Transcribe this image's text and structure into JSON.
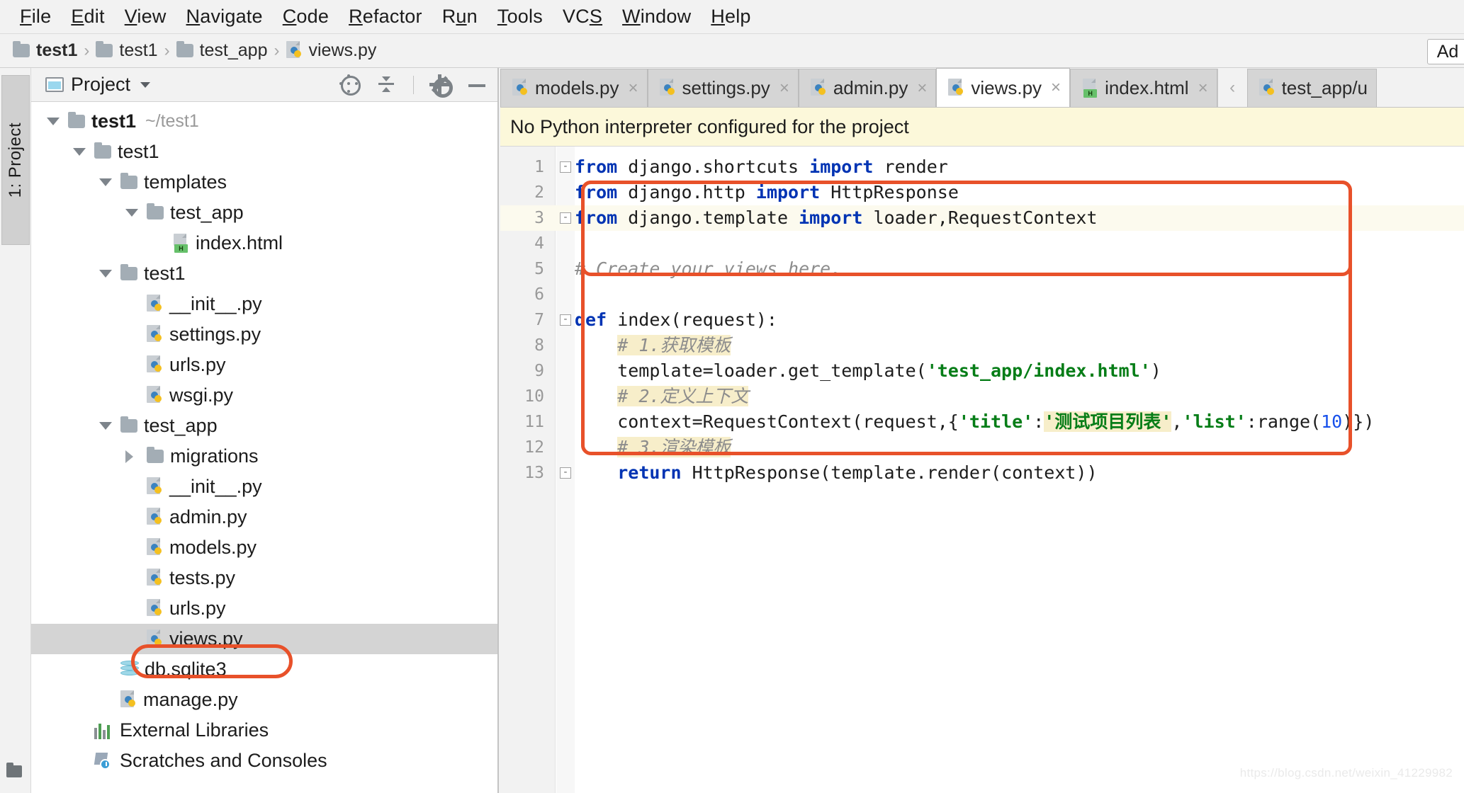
{
  "menu": {
    "items": [
      {
        "label": "File",
        "mnemonic": "F"
      },
      {
        "label": "Edit",
        "mnemonic": "E"
      },
      {
        "label": "View",
        "mnemonic": "V"
      },
      {
        "label": "Navigate",
        "mnemonic": "N"
      },
      {
        "label": "Code",
        "mnemonic": "C"
      },
      {
        "label": "Refactor",
        "mnemonic": "R"
      },
      {
        "label": "Run",
        "mnemonic": "u"
      },
      {
        "label": "Tools",
        "mnemonic": "T"
      },
      {
        "label": "VCS",
        "mnemonic": "S"
      },
      {
        "label": "Window",
        "mnemonic": "W"
      },
      {
        "label": "Help",
        "mnemonic": "H"
      }
    ]
  },
  "breadcrumb": {
    "separator": "›",
    "items": [
      {
        "label": "test1",
        "icon": "folder-icon",
        "bold": true
      },
      {
        "label": "test1",
        "icon": "folder-icon",
        "bold": false
      },
      {
        "label": "test_app",
        "icon": "folder-icon",
        "bold": false
      },
      {
        "label": "views.py",
        "icon": "python-file-icon",
        "bold": false
      }
    ],
    "add_button_label": "Ad"
  },
  "toolstrip": {
    "project_label": "1: Project",
    "folder_icon": "folder-icon"
  },
  "project_panel": {
    "title": "Project",
    "dropdown_icon": "chevron-down-icon",
    "window_icon": "project-window-icon",
    "header_icons": [
      {
        "name": "locate-target-icon"
      },
      {
        "name": "collapse-all-icon"
      },
      {
        "name": "gear-icon"
      },
      {
        "name": "minimize-icon"
      }
    ],
    "tree": [
      {
        "label": "test1",
        "path": "~/test1",
        "icon": "folder-icon",
        "indent": 0,
        "toggle": "down",
        "bold": true,
        "selected": false
      },
      {
        "label": "test1",
        "path": "",
        "icon": "folder-icon",
        "indent": 1,
        "toggle": "down",
        "bold": false,
        "selected": false
      },
      {
        "label": "templates",
        "path": "",
        "icon": "folder-icon",
        "indent": 2,
        "toggle": "down",
        "bold": false,
        "selected": false
      },
      {
        "label": "test_app",
        "path": "",
        "icon": "folder-icon",
        "indent": 3,
        "toggle": "down",
        "bold": false,
        "selected": false
      },
      {
        "label": "index.html",
        "path": "",
        "icon": "html-file-icon",
        "indent": 4,
        "toggle": "none",
        "bold": false,
        "selected": false
      },
      {
        "label": "test1",
        "path": "",
        "icon": "folder-icon",
        "indent": 2,
        "toggle": "down",
        "bold": false,
        "selected": false
      },
      {
        "label": "__init__.py",
        "path": "",
        "icon": "python-file-icon",
        "indent": 3,
        "toggle": "none",
        "bold": false,
        "selected": false
      },
      {
        "label": "settings.py",
        "path": "",
        "icon": "python-file-icon",
        "indent": 3,
        "toggle": "none",
        "bold": false,
        "selected": false
      },
      {
        "label": "urls.py",
        "path": "",
        "icon": "python-file-icon",
        "indent": 3,
        "toggle": "none",
        "bold": false,
        "selected": false
      },
      {
        "label": "wsgi.py",
        "path": "",
        "icon": "python-file-icon",
        "indent": 3,
        "toggle": "none",
        "bold": false,
        "selected": false
      },
      {
        "label": "test_app",
        "path": "",
        "icon": "folder-icon",
        "indent": 2,
        "toggle": "down",
        "bold": false,
        "selected": false
      },
      {
        "label": "migrations",
        "path": "",
        "icon": "folder-icon",
        "indent": 3,
        "toggle": "right",
        "bold": false,
        "selected": false
      },
      {
        "label": "__init__.py",
        "path": "",
        "icon": "python-file-icon",
        "indent": 3,
        "toggle": "none",
        "bold": false,
        "selected": false
      },
      {
        "label": "admin.py",
        "path": "",
        "icon": "python-file-icon",
        "indent": 3,
        "toggle": "none",
        "bold": false,
        "selected": false
      },
      {
        "label": "models.py",
        "path": "",
        "icon": "python-file-icon",
        "indent": 3,
        "toggle": "none",
        "bold": false,
        "selected": false
      },
      {
        "label": "tests.py",
        "path": "",
        "icon": "python-file-icon",
        "indent": 3,
        "toggle": "none",
        "bold": false,
        "selected": false
      },
      {
        "label": "urls.py",
        "path": "",
        "icon": "python-file-icon",
        "indent": 3,
        "toggle": "none",
        "bold": false,
        "selected": false
      },
      {
        "label": "views.py",
        "path": "",
        "icon": "python-file-icon",
        "indent": 3,
        "toggle": "none",
        "bold": false,
        "selected": true
      },
      {
        "label": "db.sqlite3",
        "path": "",
        "icon": "sqlite-db-icon",
        "indent": 2,
        "toggle": "none",
        "bold": false,
        "selected": false
      },
      {
        "label": "manage.py",
        "path": "",
        "icon": "python-file-icon",
        "indent": 2,
        "toggle": "none",
        "bold": false,
        "selected": false
      },
      {
        "label": "External Libraries",
        "path": "",
        "icon": "external-libraries-icon",
        "indent": 1,
        "toggle": "none",
        "bold": false,
        "selected": false
      },
      {
        "label": "Scratches and Consoles",
        "path": "",
        "icon": "scratches-icon",
        "indent": 1,
        "toggle": "none",
        "bold": false,
        "selected": false
      }
    ]
  },
  "editor": {
    "tabs": [
      {
        "label": "models.py",
        "icon": "python-file-icon",
        "active": false,
        "close": "×"
      },
      {
        "label": "settings.py",
        "icon": "python-file-icon",
        "active": false,
        "close": "×"
      },
      {
        "label": "admin.py",
        "icon": "python-file-icon",
        "active": false,
        "close": "×"
      },
      {
        "label": "views.py",
        "icon": "python-file-icon",
        "active": true,
        "close": "×"
      },
      {
        "label": "index.html",
        "icon": "html-file-icon",
        "active": false,
        "close": "×"
      },
      {
        "label": "test_app/u",
        "icon": "python-file-icon",
        "active": false,
        "close": ""
      }
    ],
    "tab_scroll_icon": "‹",
    "warning_banner": "No Python interpreter configured for the project",
    "file_name": "views.py",
    "lines": [
      {
        "n": 1,
        "caret": false,
        "fold": "minus",
        "tokens": [
          {
            "t": "from",
            "c": "kw"
          },
          {
            "t": " django.shortcuts ",
            "c": ""
          },
          {
            "t": "import",
            "c": "kw"
          },
          {
            "t": " render",
            "c": ""
          }
        ]
      },
      {
        "n": 2,
        "caret": false,
        "fold": "",
        "tokens": [
          {
            "t": "from",
            "c": "kw"
          },
          {
            "t": " django.http ",
            "c": ""
          },
          {
            "t": "import",
            "c": "kw"
          },
          {
            "t": " HttpResponse",
            "c": ""
          }
        ]
      },
      {
        "n": 3,
        "caret": true,
        "fold": "minus",
        "tokens": [
          {
            "t": "from",
            "c": "kw"
          },
          {
            "t": " django.template ",
            "c": ""
          },
          {
            "t": "import",
            "c": "kw"
          },
          {
            "t": " loader,RequestContext",
            "c": ""
          }
        ]
      },
      {
        "n": 4,
        "caret": false,
        "fold": "",
        "tokens": []
      },
      {
        "n": 5,
        "caret": false,
        "fold": "",
        "tokens": [
          {
            "t": "# Create your views here.",
            "c": "com"
          }
        ]
      },
      {
        "n": 6,
        "caret": false,
        "fold": "",
        "tokens": []
      },
      {
        "n": 7,
        "caret": false,
        "fold": "minus",
        "tokens": [
          {
            "t": "def",
            "c": "kw"
          },
          {
            "t": " index(request):",
            "c": ""
          }
        ]
      },
      {
        "n": 8,
        "caret": false,
        "fold": "",
        "tokens": [
          {
            "t": "    ",
            "c": ""
          },
          {
            "t": "# 1.获取模板",
            "c": "cnhl"
          }
        ]
      },
      {
        "n": 9,
        "caret": false,
        "fold": "",
        "tokens": [
          {
            "t": "    template=loader.get_template(",
            "c": ""
          },
          {
            "t": "'test_app/index.html'",
            "c": "str"
          },
          {
            "t": ")",
            "c": ""
          }
        ]
      },
      {
        "n": 10,
        "caret": false,
        "fold": "",
        "tokens": [
          {
            "t": "    ",
            "c": ""
          },
          {
            "t": "# 2.定义上下文",
            "c": "cnhl"
          }
        ]
      },
      {
        "n": 11,
        "caret": false,
        "fold": "",
        "tokens": [
          {
            "t": "    context=RequestContext(request,{",
            "c": ""
          },
          {
            "t": "'title'",
            "c": "str"
          },
          {
            "t": ":",
            "c": ""
          },
          {
            "t": "'测试项目列表'",
            "c": "strhl"
          },
          {
            "t": ",",
            "c": ""
          },
          {
            "t": "'list'",
            "c": "str"
          },
          {
            "t": ":range(",
            "c": ""
          },
          {
            "t": "10",
            "c": "num"
          },
          {
            "t": ")})",
            "c": ""
          }
        ]
      },
      {
        "n": 12,
        "caret": false,
        "fold": "",
        "tokens": [
          {
            "t": "    ",
            "c": ""
          },
          {
            "t": "# 3.渲染模板",
            "c": "cnhl"
          }
        ]
      },
      {
        "n": 13,
        "caret": false,
        "fold": "minus",
        "tokens": [
          {
            "t": "    ",
            "c": ""
          },
          {
            "t": "return",
            "c": "kw"
          },
          {
            "t": " HttpResponse(template.render(context))",
            "c": ""
          }
        ]
      }
    ]
  },
  "annotations": {
    "color": "#e8512a",
    "boxes": [
      {
        "name": "code-block-highlight"
      },
      {
        "name": "views-py-file-highlight"
      }
    ]
  },
  "watermark": "https://blog.csdn.net/weixin_41229982"
}
